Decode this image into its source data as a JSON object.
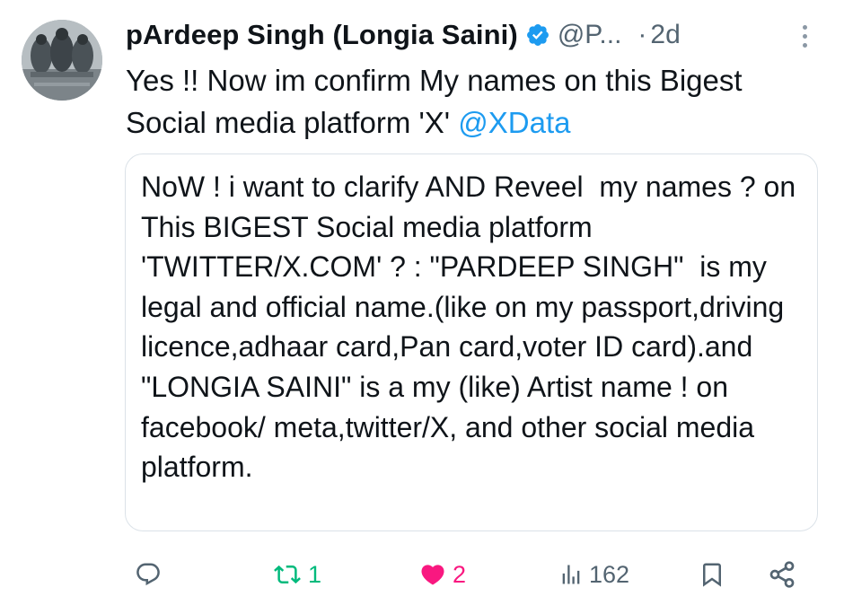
{
  "author": {
    "display_name": "pArdeep Singh (Longia Saini)",
    "handle": "@P...",
    "separator": "·",
    "time": "2d",
    "avatar": "avatar-photo",
    "verified_icon": "verified-badge-icon"
  },
  "tweet": {
    "text_before_mention": "Yes !! Now im confirm My names on this Bigest Social media platform 'X' ",
    "mention": "@XData"
  },
  "quote": {
    "text": "NoW ! i want to clarify AND Reveel  my names ? on This BIGEST Social media platform 'TWITTER/X.COM' ? : \"PARDEEP SINGH\"  is my legal and official name.(like on my passport,driving licence,adhaar card,Pan card,voter ID card).and \"LONGIA SAINI\" is a my (like) Artist name ! on facebook/ meta,twitter/X, and other social media platform."
  },
  "actions": {
    "reply_count": "",
    "repost_count": "1",
    "like_count": "2",
    "views_count": "162"
  },
  "colors": {
    "accent": "#1d9bf0",
    "repost": "#00ba7c",
    "like": "#f91880",
    "muted": "#536471"
  }
}
